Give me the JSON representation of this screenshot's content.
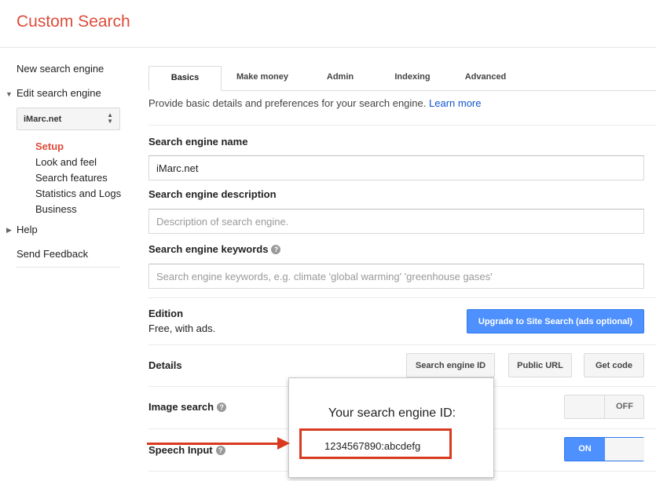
{
  "app": {
    "title": "Custom Search"
  },
  "sidebar": {
    "new_engine": "New search engine",
    "edit_engine": "Edit search engine",
    "selected_site": "iMarc.net",
    "sub_items": [
      "Setup",
      "Look and feel",
      "Search features",
      "Statistics and Logs",
      "Business"
    ],
    "help": "Help",
    "feedback": "Send Feedback"
  },
  "tabs": [
    {
      "label": "Basics",
      "active": true
    },
    {
      "label": "Make money",
      "active": false
    },
    {
      "label": "Admin",
      "active": false
    },
    {
      "label": "Indexing",
      "active": false
    },
    {
      "label": "Advanced",
      "active": false
    }
  ],
  "intro": {
    "text": "Provide basic details and preferences for your search engine.",
    "link": "Learn more"
  },
  "fields": {
    "name_label": "Search engine name",
    "name_value": "iMarc.net",
    "description_label": "Search engine description",
    "description_placeholder": "Description of search engine.",
    "keywords_label": "Search engine keywords",
    "keywords_placeholder": "Search engine keywords, e.g. climate 'global warming' 'greenhouse gases'"
  },
  "edition": {
    "label": "Edition",
    "value": "Free, with ads.",
    "upgrade_button": "Upgrade to Site Search (ads optional)"
  },
  "details": {
    "label": "Details",
    "buttons": [
      "Search engine ID",
      "Public URL",
      "Get code"
    ]
  },
  "image_search": {
    "label": "Image search",
    "state": "OFF"
  },
  "speech_input": {
    "label": "Speech Input",
    "state": "ON"
  },
  "popup": {
    "title": "Your search engine ID:",
    "engine_id": "1234567890:abcdefg"
  },
  "icons": {
    "help": "help-icon",
    "select": "chevron-updown-icon",
    "expand": "triangle-icon"
  },
  "colors": {
    "brand": "#dd4b39",
    "primary_button": "#4d90fe",
    "link": "#1155cc",
    "annotation": "#d93a1f"
  }
}
